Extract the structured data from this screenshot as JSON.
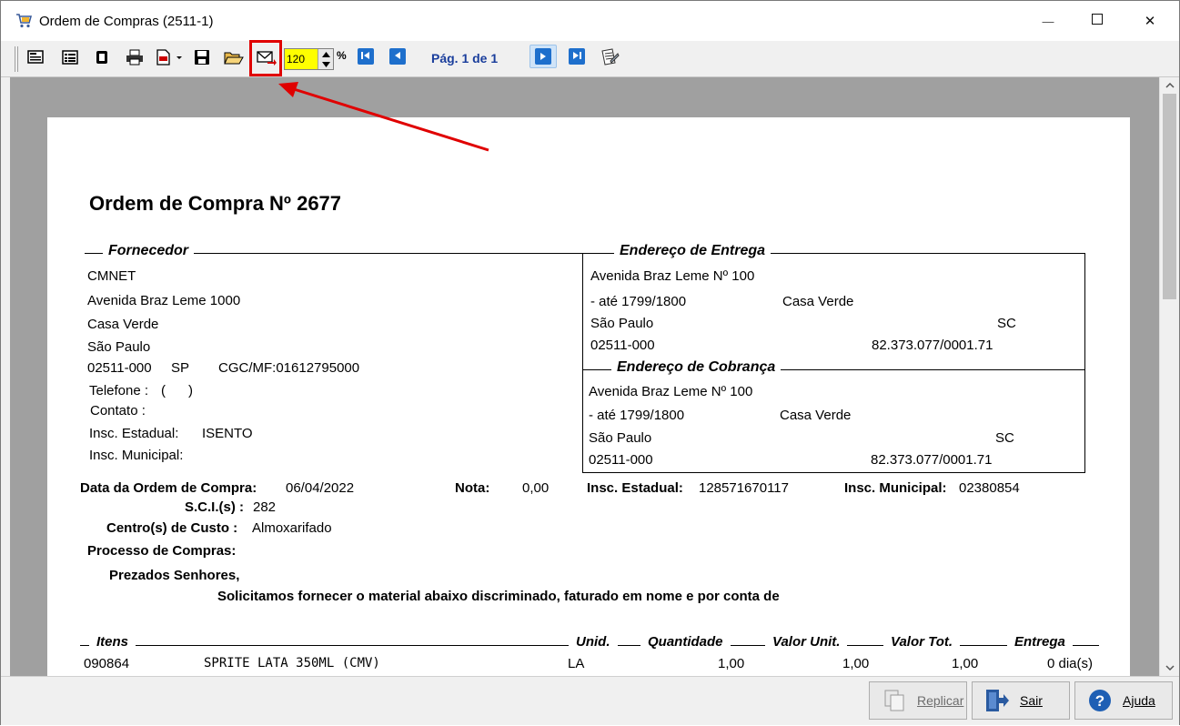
{
  "window": {
    "title": "Ordem de Compras (2511-1)",
    "min_glyph": "—",
    "max_glyph": "☐",
    "close_glyph": "✕"
  },
  "toolbar": {
    "zoom_value": "120",
    "zoom_unit": "%",
    "page_label": "Pág. 1 de 1",
    "highlight_color": "#e00000"
  },
  "document": {
    "title": "Ordem de Compra Nº  2677",
    "fornecedor": {
      "heading": "Fornecedor",
      "name": "CMNET",
      "address": "Avenida Braz Leme 1000",
      "district": "Casa Verde",
      "city": "São Paulo",
      "cep": "02511-000",
      "state": "SP",
      "cgc": "CGC/MF:01612795000",
      "telefone_label": "Telefone :",
      "telefone_value": "(      )",
      "contato_label": "Contato :",
      "insc_estadual_label": "Insc. Estadual:",
      "insc_estadual_value": "ISENTO",
      "insc_municipal_label": "Insc. Municipal:"
    },
    "entrega": {
      "heading": "Endereço de Entrega",
      "address": "Avenida Braz Leme Nº 100",
      "complement": "- até 1799/1800",
      "district": "Casa Verde",
      "city": "São Paulo",
      "state": "SC",
      "cep": "02511-000",
      "cnpj": "82.373.077/0001.71"
    },
    "cobranca": {
      "heading": "Endereço de Cobrança",
      "address": "Avenida Braz Leme Nº 100",
      "complement": "- até 1799/1800",
      "district": "Casa Verde",
      "city": "São Paulo",
      "state": "SC",
      "cep": "02511-000",
      "cnpj": "82.373.077/0001.71"
    },
    "meta": {
      "data_label": "Data da Ordem de Compra:",
      "data_value": "06/04/2022",
      "nota_label": "Nota:",
      "nota_value": "0,00",
      "insc_estadual_label": "Insc. Estadual:",
      "insc_estadual_value": "128571670117",
      "insc_municipal_label": "Insc. Municipal:",
      "insc_municipal_value": "02380854",
      "sci_label": "S.C.I.(s) :",
      "sci_value": "282",
      "centro_label": "Centro(s) de Custo :",
      "centro_value": "Almoxarifado",
      "processo_label": "Processo de Compras:"
    },
    "letter": {
      "greeting": "Prezados Senhores,",
      "body": "Solicitamos fornecer o material abaixo discriminado, faturado em nome e por conta de"
    },
    "items_header": {
      "itens": "Itens",
      "unid": "Unid.",
      "quantidade": "Quantidade",
      "valor_unit": "Valor Unit.",
      "valor_tot": "Valor Tot.",
      "entrega": "Entrega"
    },
    "items": [
      {
        "code": "090864",
        "description": "SPRITE LATA 350ML (CMV)",
        "unit": "LA",
        "quantity": "1,00",
        "unit_price": "1,00",
        "total": "1,00",
        "delivery": "0 dia(s)"
      }
    ]
  },
  "bottom": {
    "replicar_label": "Replicar",
    "sair_label": "Sair",
    "ajuda_label": "Ajuda"
  }
}
